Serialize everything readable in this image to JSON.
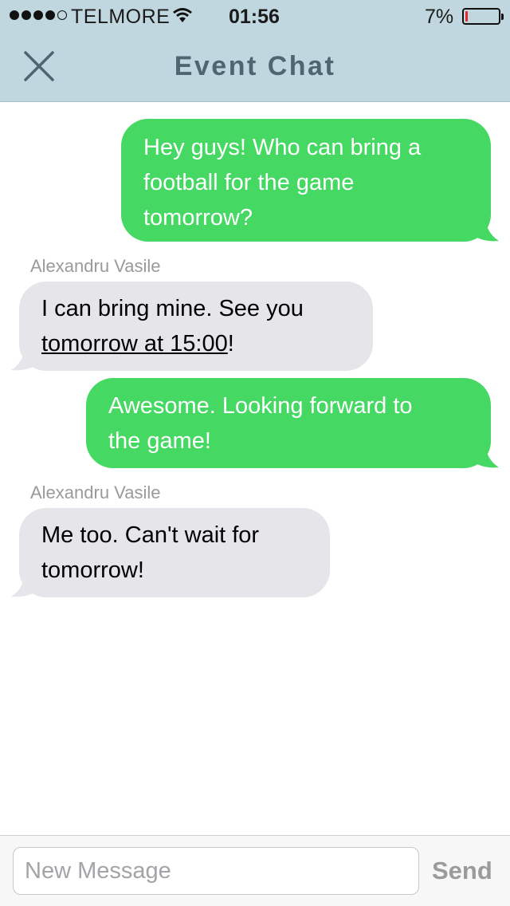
{
  "status_bar": {
    "carrier": "TELMORE",
    "time": "01:56",
    "battery_percent": "7%",
    "battery_level": 0.07,
    "signal_bars_filled": 4,
    "signal_bars_total": 5
  },
  "nav": {
    "title": "Event Chat",
    "close_icon": "close-icon"
  },
  "messages": [
    {
      "direction": "outgoing",
      "lines": [
        "Hey guys! Who can bring a",
        "football for the game",
        "tomorrow?"
      ]
    },
    {
      "direction": "incoming",
      "sender": "Alexandru Vasile",
      "line1": "I can bring mine. See you",
      "link_text": "tomorrow at 15:00",
      "after_link": "!"
    },
    {
      "direction": "outgoing",
      "lines": [
        "Awesome. Looking forward to",
        "the game!"
      ]
    },
    {
      "direction": "incoming",
      "sender": "Alexandru Vasile",
      "lines": [
        "Me too. Can't wait for",
        "tomorrow!"
      ]
    }
  ],
  "composer": {
    "placeholder": "New Message",
    "value": "",
    "send_label": "Send"
  },
  "colors": {
    "header_bg": "#c0d7df",
    "title": "#4d6672",
    "outgoing_bubble": "#45d862",
    "incoming_bubble": "#e6e5ea",
    "battery_low": "#e32b2b"
  }
}
